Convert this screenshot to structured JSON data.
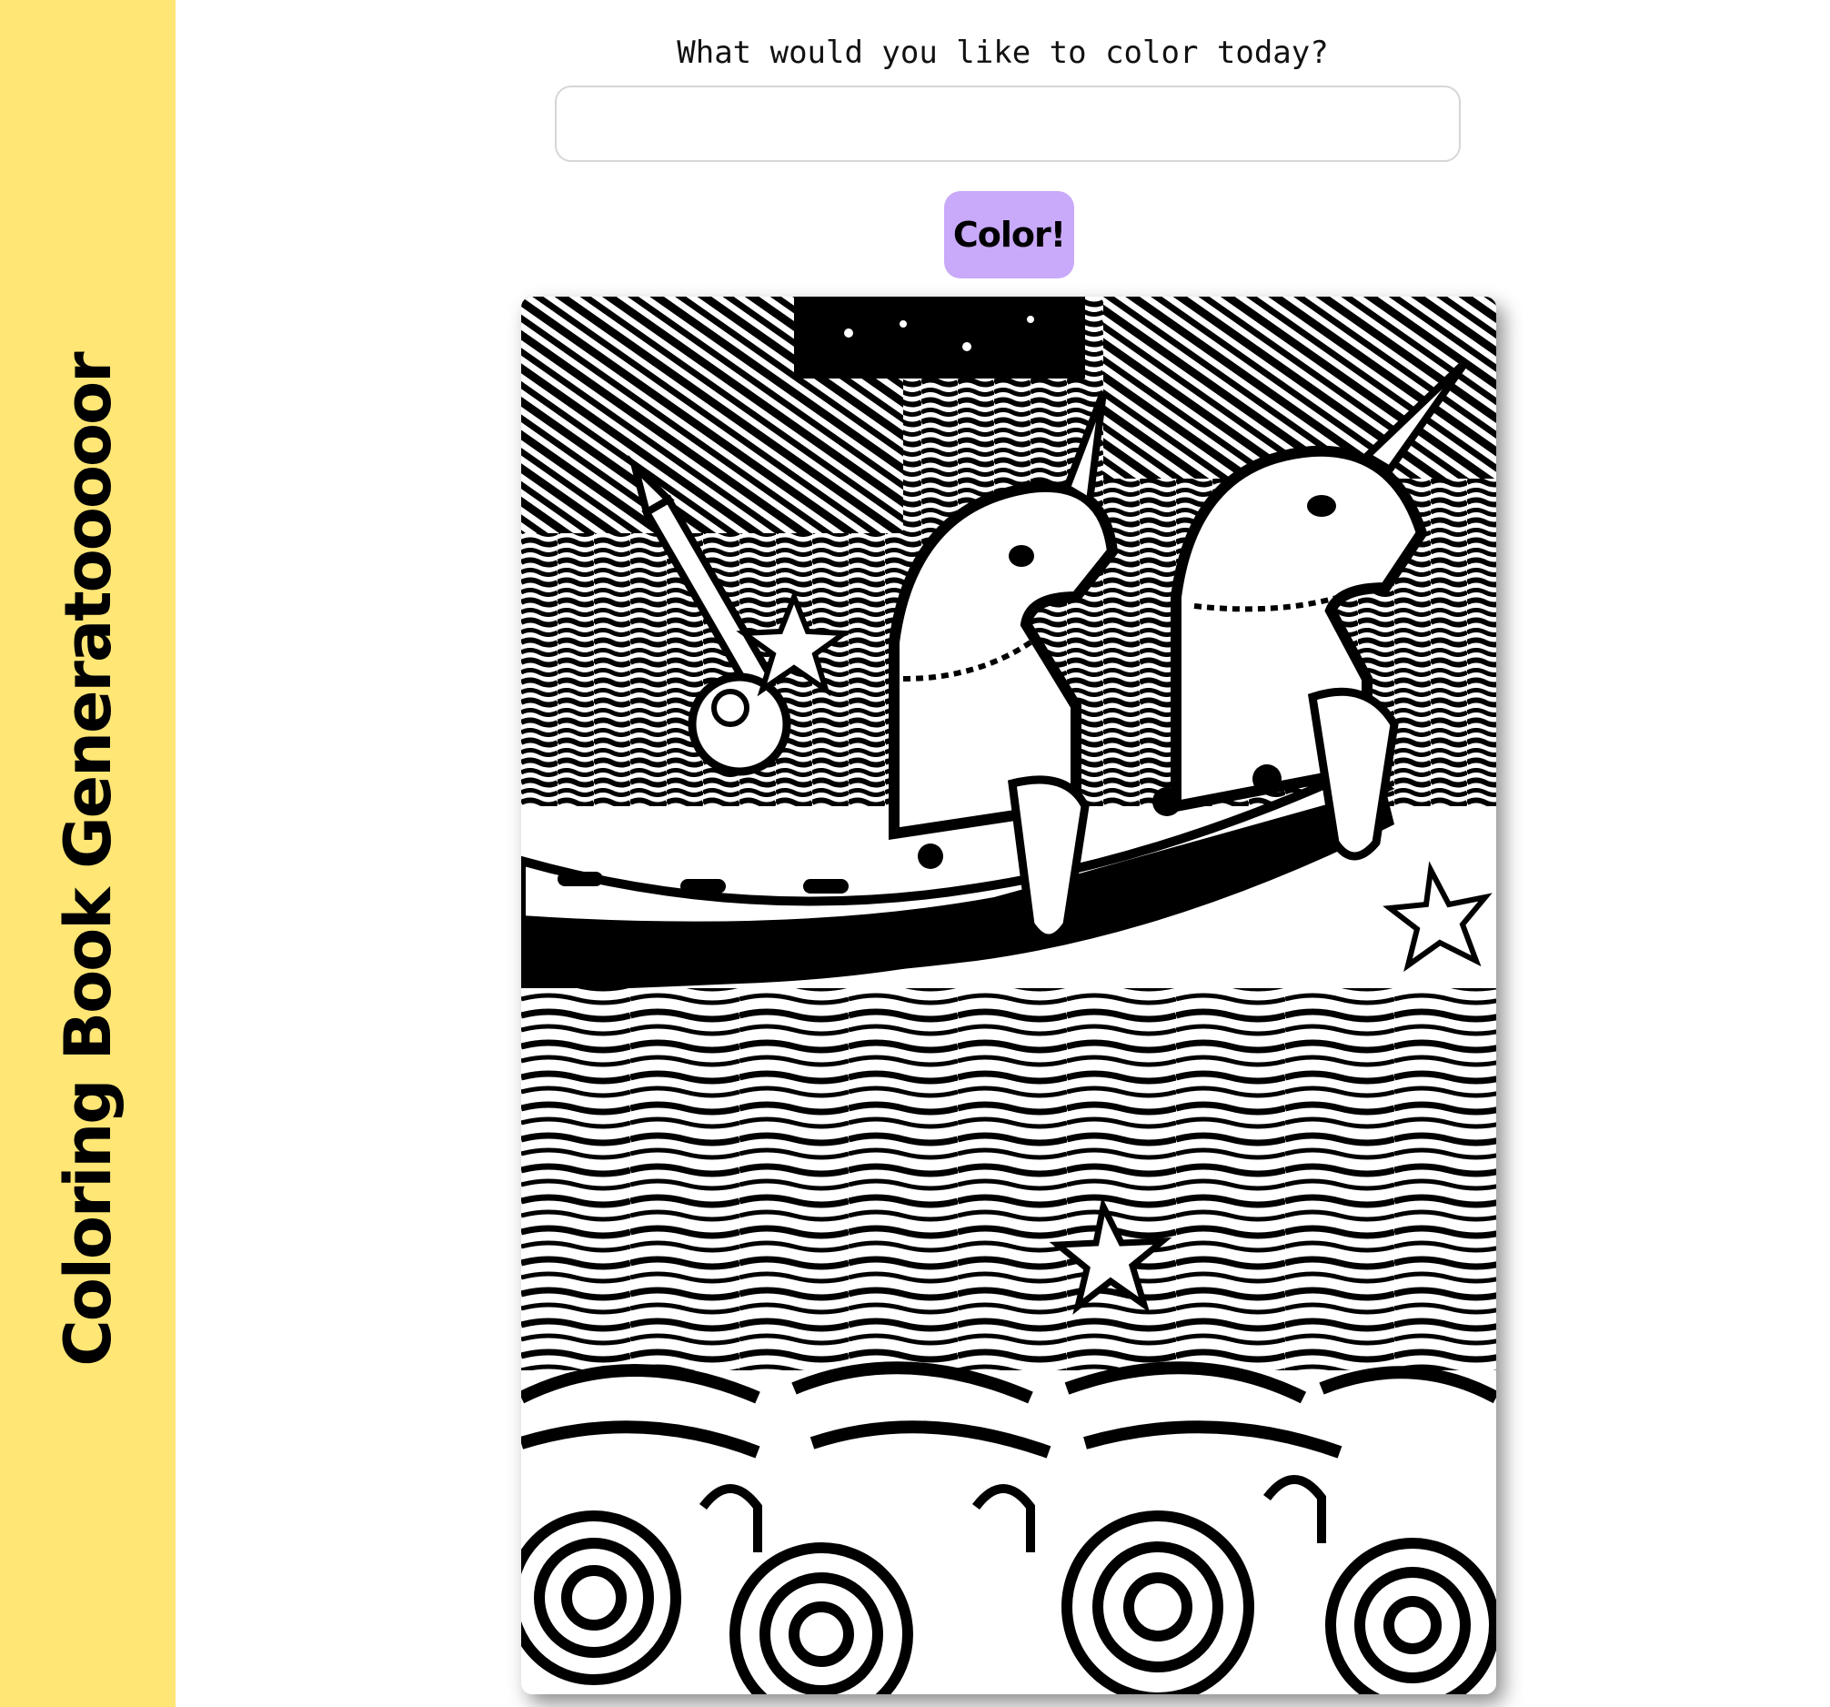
{
  "sidebar": {
    "title": "Coloring Book Generatooooor",
    "background_color": "#ffe675"
  },
  "prompt": {
    "label": "What would you like to color today?",
    "value": "",
    "placeholder": ""
  },
  "color_button": {
    "label": "Color!",
    "background_color": "#c9a9f9"
  },
  "generated_image": {
    "subject": "coloring-page-unicorns-in-boat",
    "style": "black and white line art"
  }
}
